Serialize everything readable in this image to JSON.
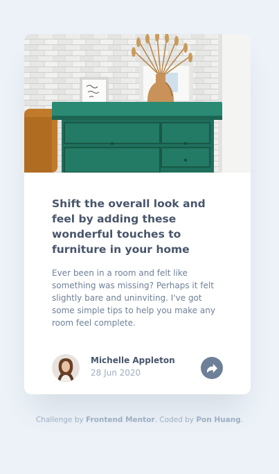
{
  "card": {
    "image_alt": "drawers",
    "title": "Shift the overall look and feel by adding these wonderful touches to furniture in your home",
    "description": "Ever been in a room and felt like something was missing? Perhaps it felt slightly bare and uninviting. I've got some simple tips to help you make any room feel complete.",
    "author": {
      "name": "Michelle Appleton",
      "date": "28 Jun 2020"
    },
    "share_icon": "share-arrow-icon"
  },
  "attribution": {
    "prefix": "Challenge by ",
    "challenge_link": "Frontend Mentor",
    "middle": ". Coded by ",
    "coder_link": "Pon Huang",
    "suffix": "."
  },
  "colors": {
    "background": "#ecf2f8",
    "card": "#ffffff",
    "title": "#48556a",
    "text": "#6e8098",
    "muted": "#9daec2",
    "dresser": "#1f6f5c"
  }
}
